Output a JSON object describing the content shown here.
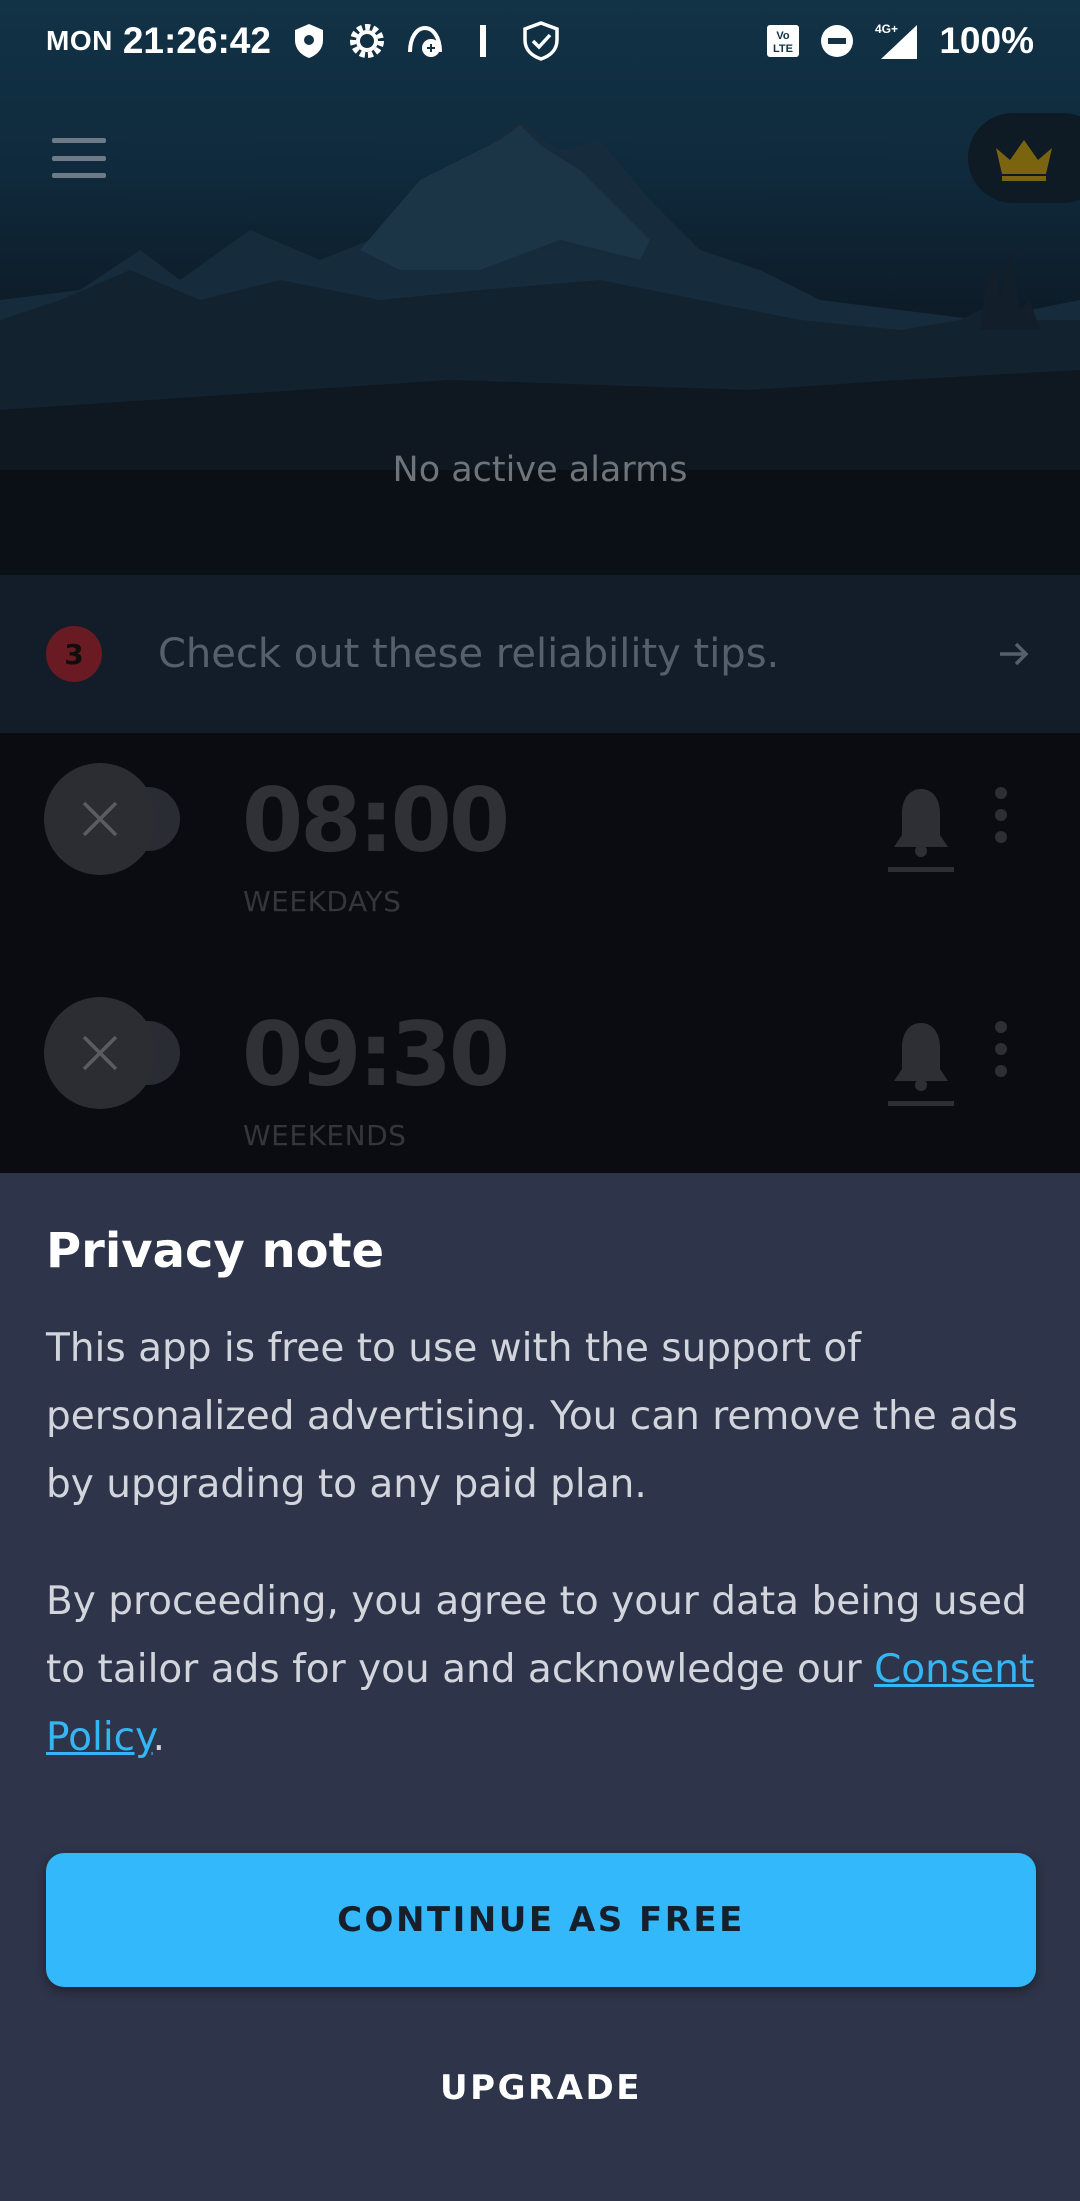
{
  "status_bar": {
    "day": "MON",
    "time": "21:26:42",
    "battery": "100%",
    "network": "4G+",
    "left_icons": [
      "shield-icon",
      "settings-icon",
      "sync-icon",
      "bar-icon",
      "shield-check-icon"
    ],
    "right_icons": [
      "volte-icon",
      "do-not-disturb-icon",
      "signal-icon"
    ]
  },
  "header": {
    "menu_icon": "hamburger-menu-icon",
    "premium_icon": "crown-icon",
    "empty_state": "No active alarms"
  },
  "tips": {
    "badge_count": "3",
    "text": "Check out these reliability tips.",
    "arrow_icon": "arrow-right-icon"
  },
  "alarms": [
    {
      "time": "08:00",
      "repeat": "WEEKDAYS",
      "enabled": false
    },
    {
      "time": "09:30",
      "repeat": "WEEKENDS",
      "enabled": false
    }
  ],
  "privacy_sheet": {
    "title": "Privacy note",
    "paragraph1": "This app is free to use with the support of personalized advertising. You can remove the ads by upgrading to any paid plan.",
    "paragraph2_prefix": "By proceeding, you agree to your data being used to tailor ads for you and acknowledge our ",
    "link_text": "Consent Policy",
    "paragraph2_suffix": ".",
    "primary_button": "CONTINUE AS FREE",
    "secondary_button": "UPGRADE"
  },
  "colors": {
    "accent": "#33b8fb",
    "sheet_bg": "#2e3449",
    "badge": "#6a1a22",
    "crown": "#7a6410"
  }
}
